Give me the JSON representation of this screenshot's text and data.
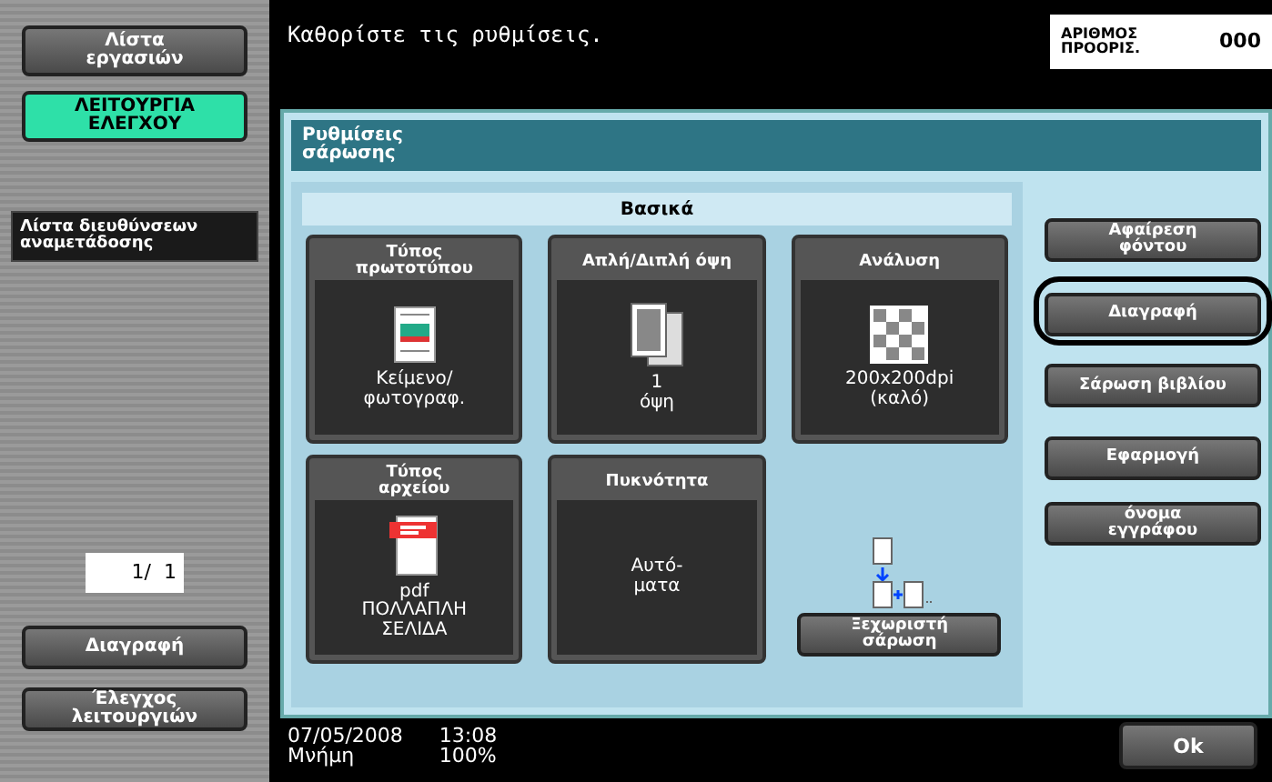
{
  "message": "Καθορίστε τις ρυθμίσεις.",
  "destination_counter": {
    "label": "ΑΡΙΘΜΟΣ\nΠΡΟΟΡΙΣ.",
    "value": "000"
  },
  "sidebar": {
    "top_buttons": [
      {
        "label": "Λίστα\nεργασιών",
        "active": false
      },
      {
        "label": "ΛΕΙΤΟΥΡΓΙΑ\nΕΛΕΓΧΟΥ",
        "active": true
      }
    ],
    "list_button": "Λίστα διευθύνσεων\nαναμετάδοσης",
    "page": "1/  1",
    "bottom_buttons": [
      "Διαγραφή",
      "Έλεγχος\nλειτουργιών"
    ]
  },
  "panel": {
    "title": "Ρυθμίσεις\nσάρωσης",
    "group_title": "Βασικά",
    "cards": [
      {
        "title": "Τύπος\nπρωτοτύπου",
        "value": "Κείμενο/\nφωτογραφ.",
        "kind": "photo-doc"
      },
      {
        "title": "Απλή/Διπλή όψη",
        "value": "1\nόψη",
        "kind": "duplex"
      },
      {
        "title": "Ανάλυση",
        "value": "200x200dpi\n(καλό)",
        "kind": "resolution"
      },
      {
        "title": "Τύπος\nαρχείου",
        "value": "pdf\nΠΟΛΛΑΠΛΗ\nΣΕΛΙΔΑ",
        "kind": "pdf"
      },
      {
        "title": "Πυκνότητα",
        "value": "Αυτό-\nματα",
        "kind": "text"
      }
    ],
    "separate_scan": "Ξεχωριστή\nσάρωση",
    "side_buttons": [
      {
        "label": "Αφαίρεση\nφόντου",
        "highlighted": false
      },
      {
        "label": "Διαγραφή",
        "highlighted": true
      },
      {
        "label": "Σάρωση βιβλίου",
        "highlighted": false
      },
      {
        "label": "Εφαρμογή",
        "highlighted": false
      },
      {
        "label": "όνομα\nεγγράφου",
        "highlighted": false
      }
    ]
  },
  "status": {
    "date": "07/05/2008",
    "time": "13:08",
    "memory_label": "Μνήμη",
    "memory_value": "100%"
  },
  "ok_button": "Ok"
}
